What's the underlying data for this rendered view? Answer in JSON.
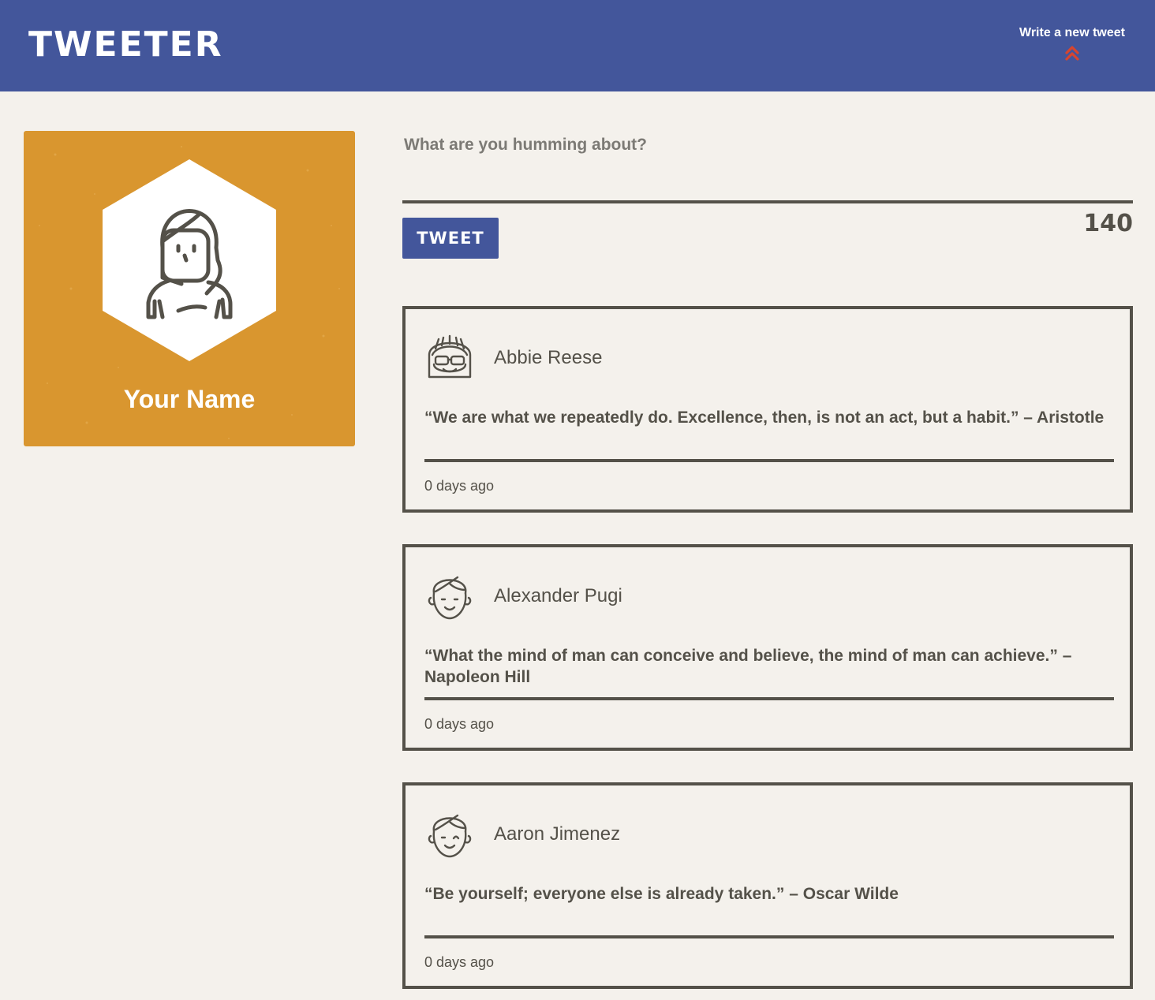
{
  "app": {
    "brand": "TWEETER"
  },
  "nav": {
    "compose_label": "Write a new tweet",
    "compose_icon": "double-chevron-up-icon",
    "compose_icon_color": "#d6452f"
  },
  "profile": {
    "name": "Your Name",
    "avatar_icon": "woman-avatar-icon",
    "background_color": "#d9962f"
  },
  "composer": {
    "placeholder": "What are you humming about?",
    "button_label": "TWEET",
    "char_count": "140"
  },
  "colors": {
    "navbar": "#43569b",
    "page": "#f4f1ec",
    "text": "#545149"
  },
  "tweets": [
    {
      "author": "Abbie Reese",
      "avatar_icon": "girl-sunglasses-avatar-icon",
      "text": "“We are what we repeatedly do. Excellence, then, is not an act, but a habit.” – Aristotle",
      "time": "0 days ago"
    },
    {
      "author": "Alexander Pugi",
      "avatar_icon": "boy-avatar-icon",
      "text": "“What the mind of man can conceive and believe, the mind of man can achieve.” – Napoleon Hill",
      "time": "0 days ago"
    },
    {
      "author": "Aaron Jimenez",
      "avatar_icon": "boy-wink-avatar-icon",
      "text": "“Be yourself; everyone else is already taken.” – Oscar Wilde",
      "time": "0 days ago"
    }
  ]
}
